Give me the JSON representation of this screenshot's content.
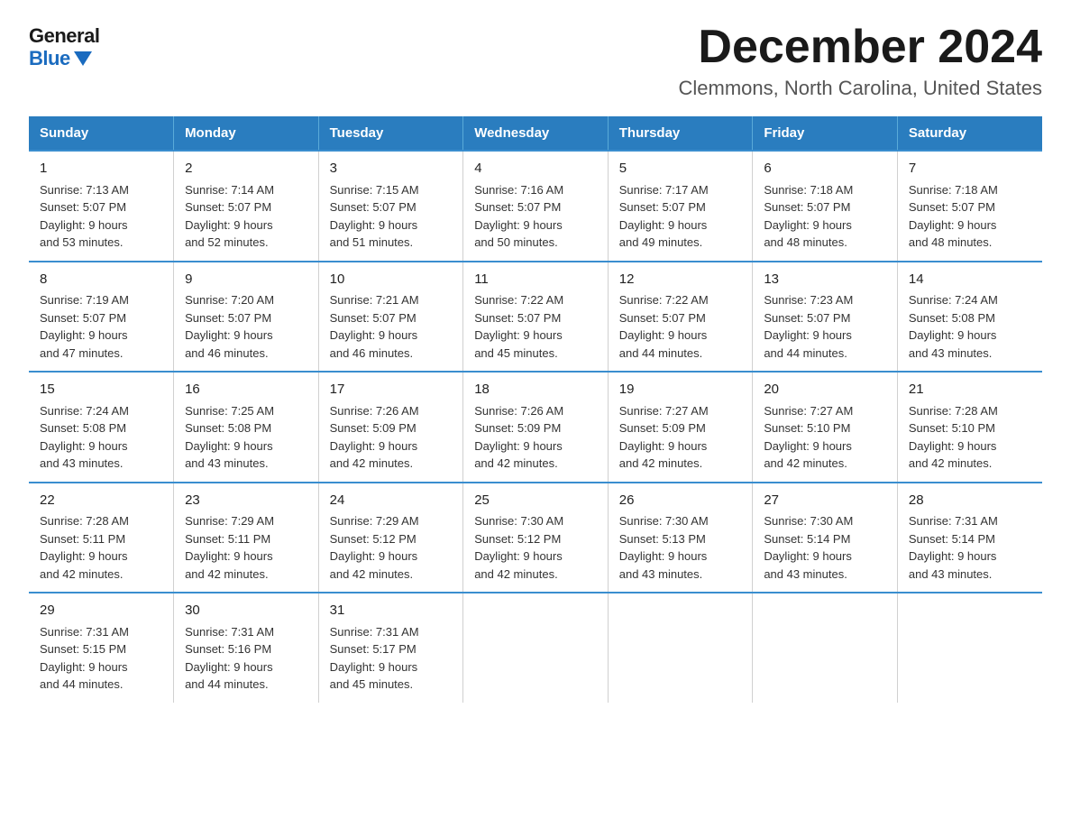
{
  "logo": {
    "general": "General",
    "blue": "Blue"
  },
  "title": "December 2024",
  "subtitle": "Clemmons, North Carolina, United States",
  "days_of_week": [
    "Sunday",
    "Monday",
    "Tuesday",
    "Wednesday",
    "Thursday",
    "Friday",
    "Saturday"
  ],
  "weeks": [
    [
      {
        "num": "1",
        "info": "Sunrise: 7:13 AM\nSunset: 5:07 PM\nDaylight: 9 hours\nand 53 minutes."
      },
      {
        "num": "2",
        "info": "Sunrise: 7:14 AM\nSunset: 5:07 PM\nDaylight: 9 hours\nand 52 minutes."
      },
      {
        "num": "3",
        "info": "Sunrise: 7:15 AM\nSunset: 5:07 PM\nDaylight: 9 hours\nand 51 minutes."
      },
      {
        "num": "4",
        "info": "Sunrise: 7:16 AM\nSunset: 5:07 PM\nDaylight: 9 hours\nand 50 minutes."
      },
      {
        "num": "5",
        "info": "Sunrise: 7:17 AM\nSunset: 5:07 PM\nDaylight: 9 hours\nand 49 minutes."
      },
      {
        "num": "6",
        "info": "Sunrise: 7:18 AM\nSunset: 5:07 PM\nDaylight: 9 hours\nand 48 minutes."
      },
      {
        "num": "7",
        "info": "Sunrise: 7:18 AM\nSunset: 5:07 PM\nDaylight: 9 hours\nand 48 minutes."
      }
    ],
    [
      {
        "num": "8",
        "info": "Sunrise: 7:19 AM\nSunset: 5:07 PM\nDaylight: 9 hours\nand 47 minutes."
      },
      {
        "num": "9",
        "info": "Sunrise: 7:20 AM\nSunset: 5:07 PM\nDaylight: 9 hours\nand 46 minutes."
      },
      {
        "num": "10",
        "info": "Sunrise: 7:21 AM\nSunset: 5:07 PM\nDaylight: 9 hours\nand 46 minutes."
      },
      {
        "num": "11",
        "info": "Sunrise: 7:22 AM\nSunset: 5:07 PM\nDaylight: 9 hours\nand 45 minutes."
      },
      {
        "num": "12",
        "info": "Sunrise: 7:22 AM\nSunset: 5:07 PM\nDaylight: 9 hours\nand 44 minutes."
      },
      {
        "num": "13",
        "info": "Sunrise: 7:23 AM\nSunset: 5:07 PM\nDaylight: 9 hours\nand 44 minutes."
      },
      {
        "num": "14",
        "info": "Sunrise: 7:24 AM\nSunset: 5:08 PM\nDaylight: 9 hours\nand 43 minutes."
      }
    ],
    [
      {
        "num": "15",
        "info": "Sunrise: 7:24 AM\nSunset: 5:08 PM\nDaylight: 9 hours\nand 43 minutes."
      },
      {
        "num": "16",
        "info": "Sunrise: 7:25 AM\nSunset: 5:08 PM\nDaylight: 9 hours\nand 43 minutes."
      },
      {
        "num": "17",
        "info": "Sunrise: 7:26 AM\nSunset: 5:09 PM\nDaylight: 9 hours\nand 42 minutes."
      },
      {
        "num": "18",
        "info": "Sunrise: 7:26 AM\nSunset: 5:09 PM\nDaylight: 9 hours\nand 42 minutes."
      },
      {
        "num": "19",
        "info": "Sunrise: 7:27 AM\nSunset: 5:09 PM\nDaylight: 9 hours\nand 42 minutes."
      },
      {
        "num": "20",
        "info": "Sunrise: 7:27 AM\nSunset: 5:10 PM\nDaylight: 9 hours\nand 42 minutes."
      },
      {
        "num": "21",
        "info": "Sunrise: 7:28 AM\nSunset: 5:10 PM\nDaylight: 9 hours\nand 42 minutes."
      }
    ],
    [
      {
        "num": "22",
        "info": "Sunrise: 7:28 AM\nSunset: 5:11 PM\nDaylight: 9 hours\nand 42 minutes."
      },
      {
        "num": "23",
        "info": "Sunrise: 7:29 AM\nSunset: 5:11 PM\nDaylight: 9 hours\nand 42 minutes."
      },
      {
        "num": "24",
        "info": "Sunrise: 7:29 AM\nSunset: 5:12 PM\nDaylight: 9 hours\nand 42 minutes."
      },
      {
        "num": "25",
        "info": "Sunrise: 7:30 AM\nSunset: 5:12 PM\nDaylight: 9 hours\nand 42 minutes."
      },
      {
        "num": "26",
        "info": "Sunrise: 7:30 AM\nSunset: 5:13 PM\nDaylight: 9 hours\nand 43 minutes."
      },
      {
        "num": "27",
        "info": "Sunrise: 7:30 AM\nSunset: 5:14 PM\nDaylight: 9 hours\nand 43 minutes."
      },
      {
        "num": "28",
        "info": "Sunrise: 7:31 AM\nSunset: 5:14 PM\nDaylight: 9 hours\nand 43 minutes."
      }
    ],
    [
      {
        "num": "29",
        "info": "Sunrise: 7:31 AM\nSunset: 5:15 PM\nDaylight: 9 hours\nand 44 minutes."
      },
      {
        "num": "30",
        "info": "Sunrise: 7:31 AM\nSunset: 5:16 PM\nDaylight: 9 hours\nand 44 minutes."
      },
      {
        "num": "31",
        "info": "Sunrise: 7:31 AM\nSunset: 5:17 PM\nDaylight: 9 hours\nand 45 minutes."
      },
      {
        "num": "",
        "info": ""
      },
      {
        "num": "",
        "info": ""
      },
      {
        "num": "",
        "info": ""
      },
      {
        "num": "",
        "info": ""
      }
    ]
  ]
}
